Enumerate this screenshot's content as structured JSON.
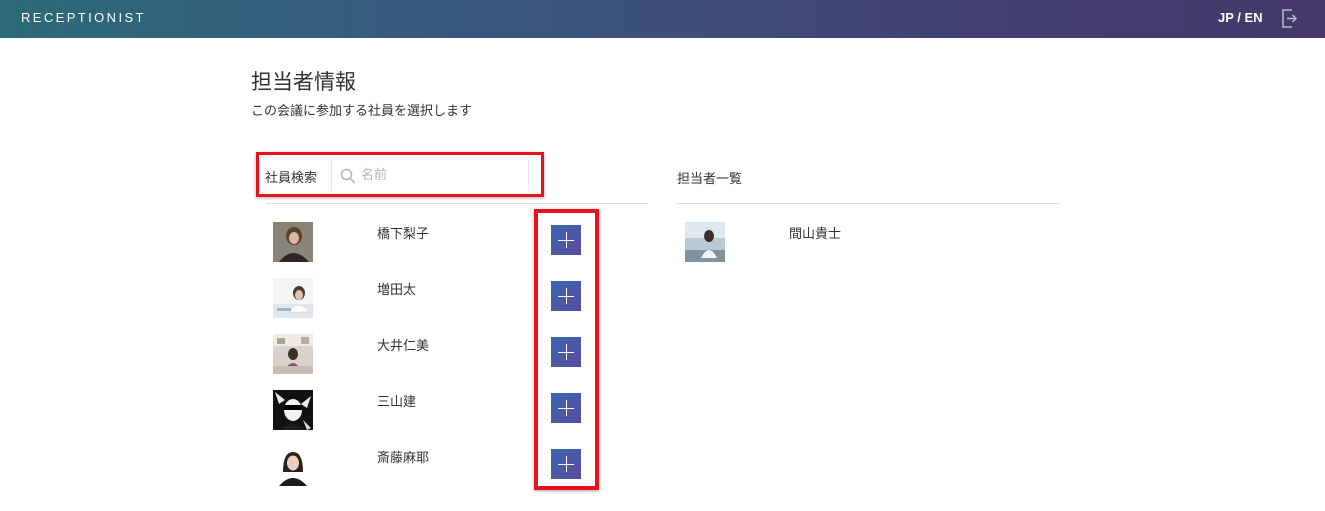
{
  "header": {
    "brand": "RECEPTIONIST",
    "language": "JP / EN",
    "logout_icon": "logout-icon"
  },
  "page": {
    "title": "担当者情報",
    "subtitle": "この会議に参加する社員を選択します"
  },
  "search": {
    "label": "社員検索",
    "placeholder": "名前",
    "value": "",
    "icon": "search-icon"
  },
  "employees": [
    {
      "name": "橋下梨子",
      "avatar": "photo-portrait-dark"
    },
    {
      "name": "増田太",
      "avatar": "photo-desk"
    },
    {
      "name": "大井仁美",
      "avatar": "photo-room"
    },
    {
      "name": "三山建",
      "avatar": "photo-sunglasses"
    },
    {
      "name": "斎藤麻耶",
      "avatar": "photo-portrait-woman"
    }
  ],
  "assignees": {
    "title": "担当者一覧",
    "items": [
      {
        "name": "間山貴士",
        "avatar": "photo-seaside"
      }
    ]
  },
  "colors": {
    "header_start": "#2c6a78",
    "header_end": "#45386a",
    "highlight": "#e6131b",
    "add_button_start": "#3a68b2",
    "add_button_end": "#5a4aa0"
  }
}
